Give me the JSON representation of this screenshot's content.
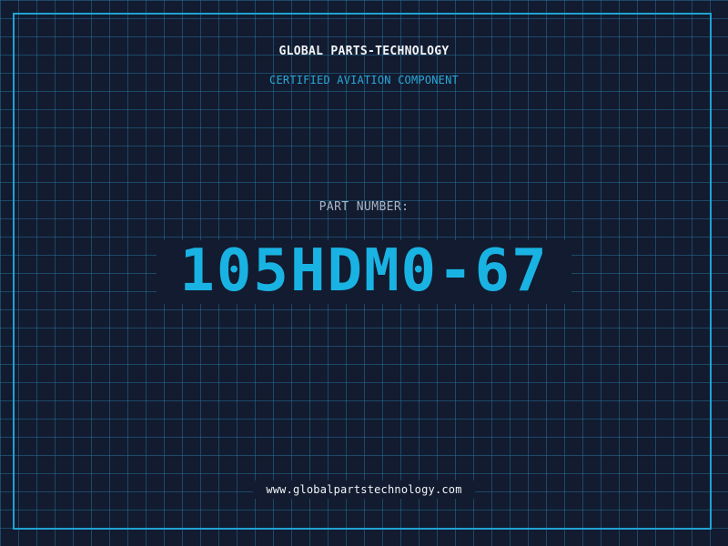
{
  "header": {
    "brand": "GLOBAL PARTS-TECHNOLOGY",
    "subtitle": "CERTIFIED AVIATION COMPONENT"
  },
  "part": {
    "label": "PART NUMBER:",
    "number": "105HDM0-67"
  },
  "footer": {
    "website": "www.globalpartstechnology.com"
  },
  "colors": {
    "background": "#121b2f",
    "grid": "#266e96",
    "accent": "#19b3e3",
    "border": "#1fa3d4",
    "text": "#f2f5f8",
    "muted": "#a9b6c6"
  }
}
